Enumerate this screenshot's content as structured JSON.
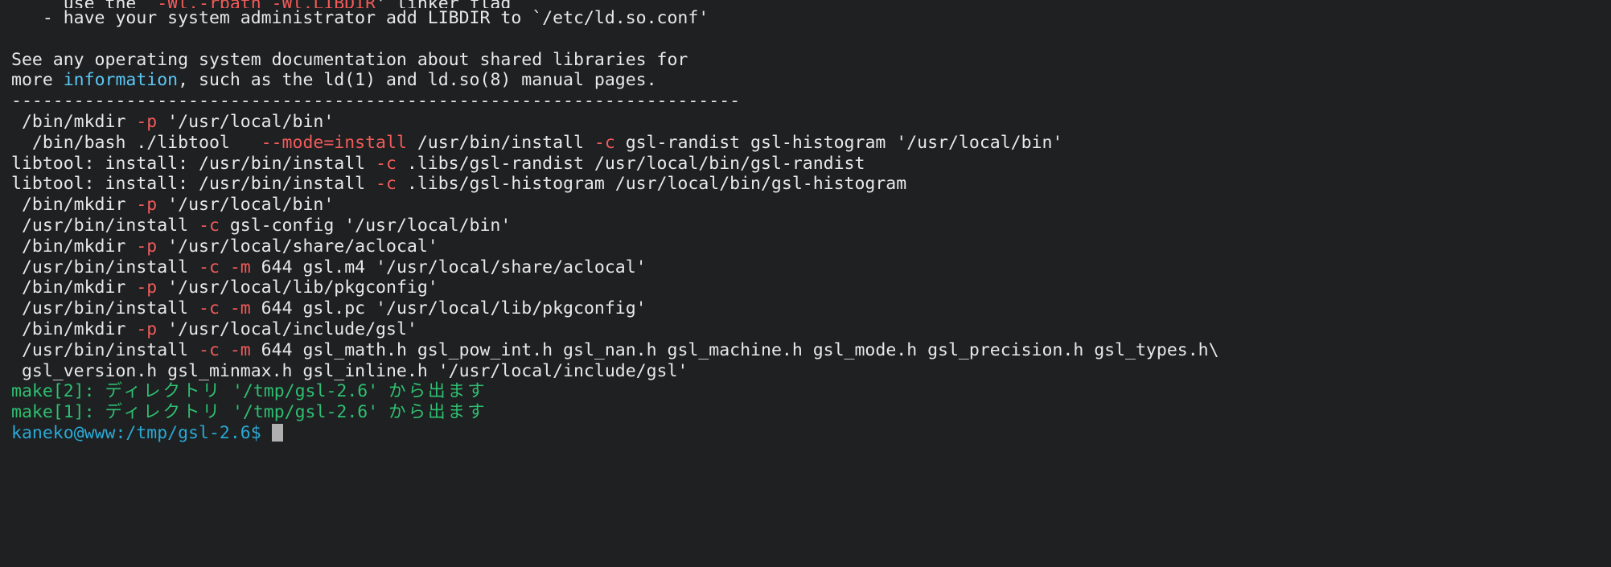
{
  "terminal": {
    "window_title": "kaneko@www: /tmp/gsl-2.6",
    "background_color": "#1e2021",
    "foreground_color": "#e8e8e8",
    "cursor_color": "#b0b0b0",
    "colors": {
      "red": "#f25a5a",
      "green": "#2fbf71",
      "cyan": "#2aa9d4",
      "light_cyan": "#5bc8f5"
    },
    "prompt": {
      "text": "kaneko@www:/tmp/gsl-2.6$",
      "color": "#2aa9d4"
    },
    "lines": [
      {
        "id": "line-01-wl-rpath",
        "clipped_top": true,
        "spans": [
          {
            "text": "     use the `",
            "color": "default"
          },
          {
            "text": "-Wl,-rpath -Wl,LIBDIR",
            "color": "red"
          },
          {
            "text": "' linker flag",
            "color": "default"
          }
        ]
      },
      {
        "id": "line-02-have-your-sysadmin",
        "spans": [
          {
            "text": "   - have your system administrator add LIBDIR to `/etc/ld.so.conf'",
            "color": "default"
          }
        ]
      },
      {
        "id": "line-03-blank",
        "spans": [
          {
            "text": "",
            "color": "default"
          }
        ]
      },
      {
        "id": "line-04-see-any-os-doc",
        "spans": [
          {
            "text": "See any operating system documentation about shared libraries for",
            "color": "default"
          }
        ]
      },
      {
        "id": "line-05-more-information",
        "spans": [
          {
            "text": "more ",
            "color": "default"
          },
          {
            "text": "information",
            "color": "light_cyan"
          },
          {
            "text": ", such as the ld(1) and ld.so(8) manual pages.",
            "color": "default"
          }
        ]
      },
      {
        "id": "line-06-separator",
        "spans": [
          {
            "text": "----------------------------------------------------------------------",
            "color": "default"
          }
        ]
      },
      {
        "id": "line-07-mkdir-bin",
        "spans": [
          {
            "text": " /bin/mkdir ",
            "color": "default"
          },
          {
            "text": "-p",
            "color": "red"
          },
          {
            "text": " '/usr/local/bin'",
            "color": "default"
          }
        ]
      },
      {
        "id": "line-08-libtool-mode-install",
        "spans": [
          {
            "text": "  /bin/bash ./libtool   ",
            "color": "default"
          },
          {
            "text": "--mode=install",
            "color": "red"
          },
          {
            "text": " /usr/bin/install ",
            "color": "default"
          },
          {
            "text": "-c",
            "color": "red"
          },
          {
            "text": " gsl-randist gsl-histogram '/usr/local/bin'",
            "color": "default"
          }
        ]
      },
      {
        "id": "line-09-libtool-install-randist",
        "spans": [
          {
            "text": "libtool: install: /usr/bin/install ",
            "color": "default"
          },
          {
            "text": "-c",
            "color": "red"
          },
          {
            "text": " .libs/gsl-randist /usr/local/bin/gsl-randist",
            "color": "default"
          }
        ]
      },
      {
        "id": "line-10-libtool-install-histogram",
        "spans": [
          {
            "text": "libtool: install: /usr/bin/install ",
            "color": "default"
          },
          {
            "text": "-c",
            "color": "red"
          },
          {
            "text": " .libs/gsl-histogram /usr/local/bin/gsl-histogram",
            "color": "default"
          }
        ]
      },
      {
        "id": "line-11-mkdir-bin-2",
        "spans": [
          {
            "text": " /bin/mkdir ",
            "color": "default"
          },
          {
            "text": "-p",
            "color": "red"
          },
          {
            "text": " '/usr/local/bin'",
            "color": "default"
          }
        ]
      },
      {
        "id": "line-12-install-gsl-config",
        "spans": [
          {
            "text": " /usr/bin/install ",
            "color": "default"
          },
          {
            "text": "-c",
            "color": "red"
          },
          {
            "text": " gsl-config '/usr/local/bin'",
            "color": "default"
          }
        ]
      },
      {
        "id": "line-13-mkdir-aclocal",
        "spans": [
          {
            "text": " /bin/mkdir ",
            "color": "default"
          },
          {
            "text": "-p",
            "color": "red"
          },
          {
            "text": " '/usr/local/share/aclocal'",
            "color": "default"
          }
        ]
      },
      {
        "id": "line-14-install-gsl-m4",
        "spans": [
          {
            "text": " /usr/bin/install ",
            "color": "default"
          },
          {
            "text": "-c",
            "color": "red"
          },
          {
            "text": " ",
            "color": "default"
          },
          {
            "text": "-m",
            "color": "red"
          },
          {
            "text": " 644 gsl.m4 '/usr/local/share/aclocal'",
            "color": "default"
          }
        ]
      },
      {
        "id": "line-15-mkdir-pkgconfig",
        "spans": [
          {
            "text": " /bin/mkdir ",
            "color": "default"
          },
          {
            "text": "-p",
            "color": "red"
          },
          {
            "text": " '/usr/local/lib/pkgconfig'",
            "color": "default"
          }
        ]
      },
      {
        "id": "line-16-install-gsl-pc",
        "spans": [
          {
            "text": " /usr/bin/install ",
            "color": "default"
          },
          {
            "text": "-c",
            "color": "red"
          },
          {
            "text": " ",
            "color": "default"
          },
          {
            "text": "-m",
            "color": "red"
          },
          {
            "text": " 644 gsl.pc '/usr/local/lib/pkgconfig'",
            "color": "default"
          }
        ]
      },
      {
        "id": "line-17-mkdir-include-gsl",
        "spans": [
          {
            "text": " /bin/mkdir ",
            "color": "default"
          },
          {
            "text": "-p",
            "color": "red"
          },
          {
            "text": " '/usr/local/include/gsl'",
            "color": "default"
          }
        ]
      },
      {
        "id": "line-18-install-headers",
        "spans": [
          {
            "text": " /usr/bin/install ",
            "color": "default"
          },
          {
            "text": "-c",
            "color": "red"
          },
          {
            "text": " ",
            "color": "default"
          },
          {
            "text": "-m",
            "color": "red"
          },
          {
            "text": " 644 gsl_math.h gsl_pow_int.h gsl_nan.h gsl_machine.h gsl_mode.h gsl_precision.h gsl_types.h\\",
            "color": "default"
          }
        ]
      },
      {
        "id": "line-19-install-headers-cont",
        "spans": [
          {
            "text": " gsl_version.h gsl_minmax.h gsl_inline.h '/usr/local/include/gsl'",
            "color": "default"
          }
        ]
      },
      {
        "id": "line-20-make2-leaving",
        "spans": [
          {
            "text": "make[2]: ",
            "color": "green"
          },
          {
            "text": "ディレクトリ",
            "color": "green",
            "jp": true
          },
          {
            "text": " '/tmp/gsl-2.6' ",
            "color": "green"
          },
          {
            "text": "から出ます",
            "color": "green",
            "jp": true
          }
        ]
      },
      {
        "id": "line-21-make1-leaving",
        "spans": [
          {
            "text": "make[1]: ",
            "color": "green"
          },
          {
            "text": "ディレクトリ",
            "color": "green",
            "jp": true
          },
          {
            "text": " '/tmp/gsl-2.6' ",
            "color": "green"
          },
          {
            "text": "から出ます",
            "color": "green",
            "jp": true
          }
        ]
      },
      {
        "id": "line-22-prompt",
        "is_prompt": true,
        "spans": [
          {
            "text": "kaneko@www:/tmp/gsl-2.6$ ",
            "color": "cyan"
          }
        ]
      }
    ]
  }
}
